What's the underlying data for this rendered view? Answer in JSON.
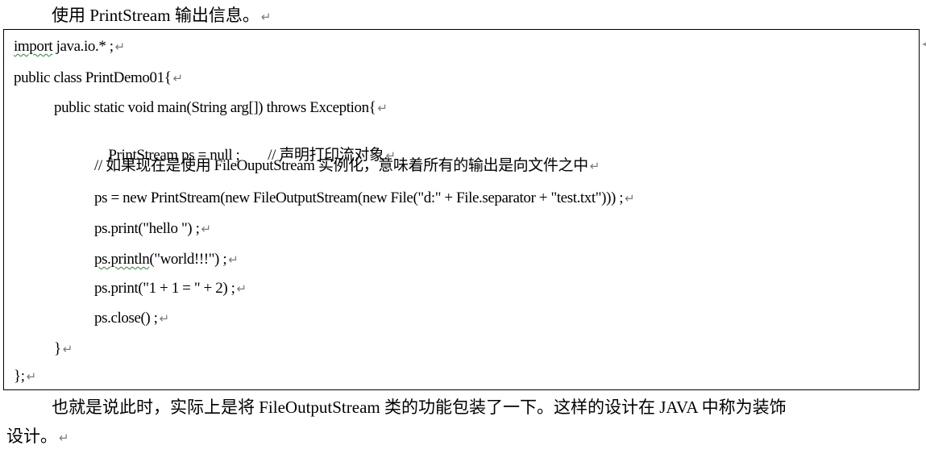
{
  "intro": {
    "text": "使用 PrintStream 输出信息。",
    "mark": "↵"
  },
  "code": {
    "lines": [
      {
        "pre": "",
        "squiggle": "import",
        "text": " java.io.* ;",
        "mark": "↵"
      },
      {
        "pre": "",
        "squiggle": "",
        "text": "public class PrintDemo01{",
        "mark": "↵"
      },
      {
        "pre": "",
        "squiggle": "",
        "text": "public static void main(String arg[]) throws Exception{",
        "mark": "↵"
      },
      {
        "pre": "",
        "squiggle": "",
        "text": "PrintStream ps = null ;        // 声明打印流对象",
        "mark": "↵"
      },
      {
        "pre": "",
        "squiggle": "",
        "text": "// 如果现在是使用 FileOuputStream 实例化，意味着所有的输出是向文件之中",
        "mark": "↵"
      },
      {
        "pre": "",
        "squiggle": "",
        "text": "ps = new PrintStream(new FileOutputStream(new File(\"d:\" + File.separator + \"test.txt\"))) ;",
        "mark": "↵"
      },
      {
        "pre": "",
        "squiggle": "",
        "text": "ps.print(\"hello \") ;",
        "mark": "↵"
      },
      {
        "pre": "",
        "squiggle": "ps.println",
        "text": "(\"world!!!\") ;",
        "mark": "↵"
      },
      {
        "pre": "",
        "squiggle": "",
        "text": "ps.print(\"1 + 1 = \" + 2) ;",
        "mark": "↵"
      },
      {
        "pre": "",
        "squiggle": "",
        "text": "ps.close() ;",
        "mark": "↵"
      },
      {
        "pre": "",
        "squiggle": "",
        "text": "}",
        "mark": "↵"
      },
      {
        "pre": "",
        "squiggle": "",
        "text": "};",
        "mark": "↵"
      }
    ]
  },
  "paragraph": {
    "line1": "也就是说此时，实际上是将 FileOutputStream 类的功能包装了一下。这样的设计在 JAVA 中称为装饰",
    "line2": "设计。",
    "mark": "↵"
  }
}
